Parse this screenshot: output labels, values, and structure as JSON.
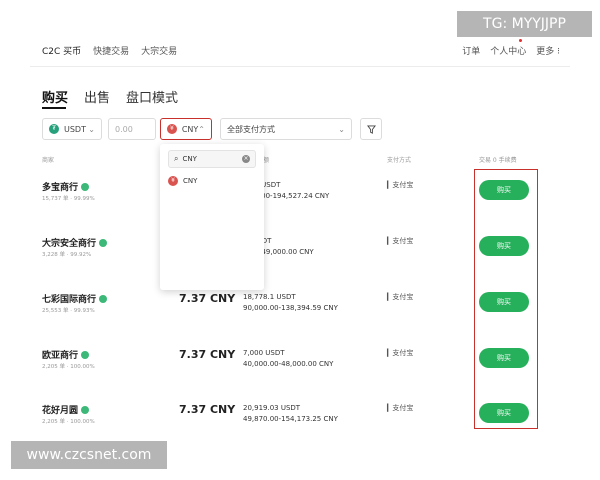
{
  "topnav": {
    "left": [
      "C2C 买币",
      "快捷交易",
      "大宗交易"
    ],
    "right": [
      "订单",
      "个人中心",
      "更多 ⁝"
    ]
  },
  "tabs": [
    "购买",
    "出售",
    "盘口模式"
  ],
  "filters": {
    "coin": "USDT",
    "amount_placeholder": "0.00",
    "fiat": "CNY",
    "payment": "全部支付方式"
  },
  "dropdown": {
    "search_value": "CNY",
    "items": [
      "CNY"
    ]
  },
  "table": {
    "headers": [
      "商家",
      "价格",
      "数量/限额",
      "支付方式",
      "交易 0 手续费"
    ],
    "rows": [
      {
        "name": "多宝商行",
        "stats": "15,737 单 · 99.99%",
        "price": "",
        "avail": "…47 USDT",
        "limit": "…00.00-194,527.24 CNY",
        "pay": "支付宝",
        "buy": "购买"
      },
      {
        "name": "大宗安全商行",
        "stats": "3,228 单 · 99.92%",
        "price": "",
        "avail": "… USDT",
        "limit": "…00-49,000.00 CNY",
        "pay": "支付宝",
        "buy": "购买"
      },
      {
        "name": "七彩国际商行",
        "stats": "25,553 单 · 99.93%",
        "price": "7.37 CNY",
        "avail": "18,778.1 USDT",
        "limit": "90,000.00-138,394.59 CNY",
        "pay": "支付宝",
        "buy": "购买"
      },
      {
        "name": "欧亚商行",
        "stats": "2,205 单 · 100.00%",
        "price": "7.37 CNY",
        "avail": "7,000 USDT",
        "limit": "40,000.00-48,000.00 CNY",
        "pay": "支付宝",
        "buy": "购买"
      },
      {
        "name": "花好月圆",
        "stats": "2,205 单 · 100.00%",
        "price": "7.37 CNY",
        "avail": "20,919.03 USDT",
        "limit": "49,870.00-154,173.25 CNY",
        "pay": "支付宝",
        "buy": "购买"
      }
    ]
  },
  "watermarks": {
    "top": "TG: MYYJJPP",
    "bottom": "www.czcsnet.com"
  },
  "colors": {
    "buy_button": "#27b05b",
    "highlight": "#c8302c",
    "verified_badge": "#3cb878"
  }
}
